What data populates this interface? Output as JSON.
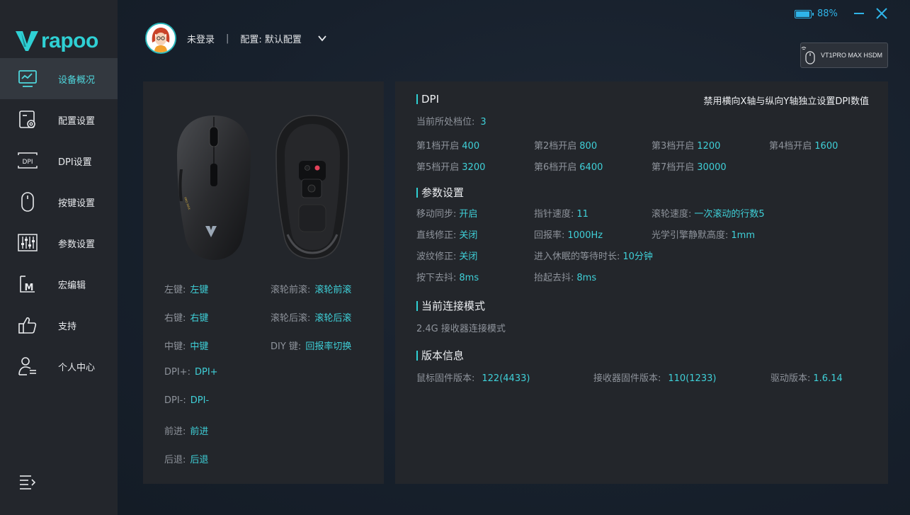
{
  "app": {
    "brand": "rapoo"
  },
  "window": {
    "battery_pct": "88%",
    "battery_level": 0.88
  },
  "sidebar": {
    "items": [
      {
        "label": "设备概况",
        "icon": "monitor-chart-icon",
        "active": true
      },
      {
        "label": "配置设置",
        "icon": "config-gear-icon"
      },
      {
        "label": "DPI设置",
        "icon": "dpi-icon"
      },
      {
        "label": "按键设置",
        "icon": "mouse-icon"
      },
      {
        "label": "参数设置",
        "icon": "sliders-icon"
      },
      {
        "label": "宏编辑",
        "icon": "macro-icon"
      },
      {
        "label": "支持",
        "icon": "thumbs-up-icon"
      },
      {
        "label": "个人中心",
        "icon": "user-list-icon"
      }
    ],
    "dpi_icon_text": "DPI",
    "macro_icon_text": "M"
  },
  "user": {
    "name": "未登录",
    "separator": "|",
    "profile": "配置: 默认配置"
  },
  "device": {
    "name": "VT1PRO MAX HSDM"
  },
  "keys": {
    "left": [
      {
        "k": "左键:",
        "v": "左键"
      },
      {
        "k": "右键:",
        "v": "右键"
      },
      {
        "k": "中键:",
        "v": "中键"
      },
      {
        "k": "DPI+:",
        "v": "DPI+"
      },
      {
        "k": "DPI-:",
        "v": "DPI-"
      },
      {
        "k": "前进:",
        "v": "前进"
      },
      {
        "k": "后退:",
        "v": "后退"
      }
    ],
    "right": [
      {
        "k": "滚轮前滚:",
        "v": "滚轮前滚"
      },
      {
        "k": "滚轮后滚:",
        "v": "滚轮后滚"
      },
      {
        "k": "DIY 键:",
        "v": "回报率切换"
      }
    ]
  },
  "dpi": {
    "title": "DPI",
    "toggle": "禁用横向X轴与纵向Y轴独立设置DPI数值",
    "current_label": "当前所处档位:",
    "current_value": "3",
    "levels": [
      {
        "k": "第1档开启",
        "v": "400"
      },
      {
        "k": "第2档开启",
        "v": "800"
      },
      {
        "k": "第3档开启",
        "v": "1200"
      },
      {
        "k": "第4档开启",
        "v": "1600"
      },
      {
        "k": "第5档开启",
        "v": "3200"
      },
      {
        "k": "第6档开启",
        "v": "6400"
      },
      {
        "k": "第7档开启",
        "v": "30000"
      }
    ]
  },
  "params": {
    "title": "参数设置",
    "items": [
      {
        "k": "移动同步:",
        "v": "开启"
      },
      {
        "k": "指针速度:",
        "v": "11"
      },
      {
        "k": "滚轮速度:",
        "v": "一次滚动的行数5"
      },
      {
        "k": "直线修正:",
        "v": "关闭"
      },
      {
        "k": "回报率:",
        "v": "1000Hz"
      },
      {
        "k": "光学引擎静默高度:",
        "v": "1mm"
      },
      {
        "k": "波纹修正:",
        "v": "关闭"
      },
      {
        "k": "进入休眠的等待时长:",
        "v": "10分钟"
      },
      {
        "k": "按下去抖:",
        "v": "8ms"
      },
      {
        "k": "抬起去抖:",
        "v": "8ms"
      }
    ]
  },
  "connection": {
    "title": "当前连接模式",
    "mode": "2.4G 接收器连接模式"
  },
  "version": {
    "title": "版本信息",
    "items": [
      {
        "k": "鼠标固件版本:",
        "v": "122(4433)"
      },
      {
        "k": "接收器固件版本:",
        "v": "110(1233)"
      },
      {
        "k": "驱动版本:",
        "v": "1.6.14"
      }
    ]
  },
  "colors": {
    "accent": "#2fd0d4",
    "battery": "#2fb4e8",
    "panel": "#23262b",
    "sidebar": "#23262c"
  }
}
